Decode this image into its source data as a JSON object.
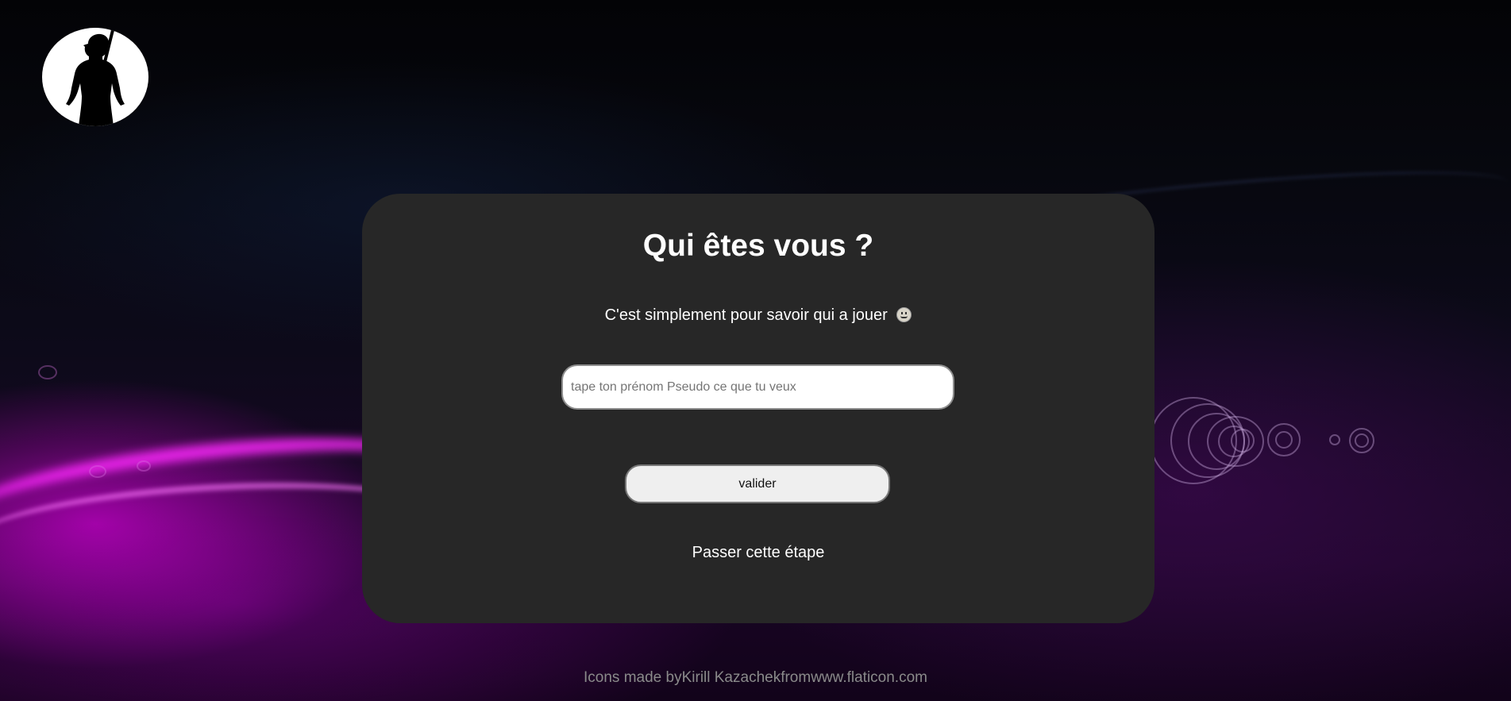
{
  "logo": {
    "icon": "soldier-silhouette-icon"
  },
  "form": {
    "title": "Qui êtes vous ?",
    "subtitle": "C'est simplement pour savoir qui a jouer",
    "subtitle_icon": "grinning-face-icon",
    "input": {
      "placeholder": "tape ton prénom Pseudo ce que tu veux",
      "value": ""
    },
    "submit_label": "valider",
    "skip_label": "Passer cette étape"
  },
  "credits": {
    "prefix": "Icons made by",
    "author": "Kirill Kazachek",
    "middle": "from",
    "site": "www.flaticon.com"
  },
  "colors": {
    "card_background": "#272727",
    "accent_glow": "#ff28ff",
    "text": "#ffffff",
    "credits_text": "#8a8a8a"
  }
}
